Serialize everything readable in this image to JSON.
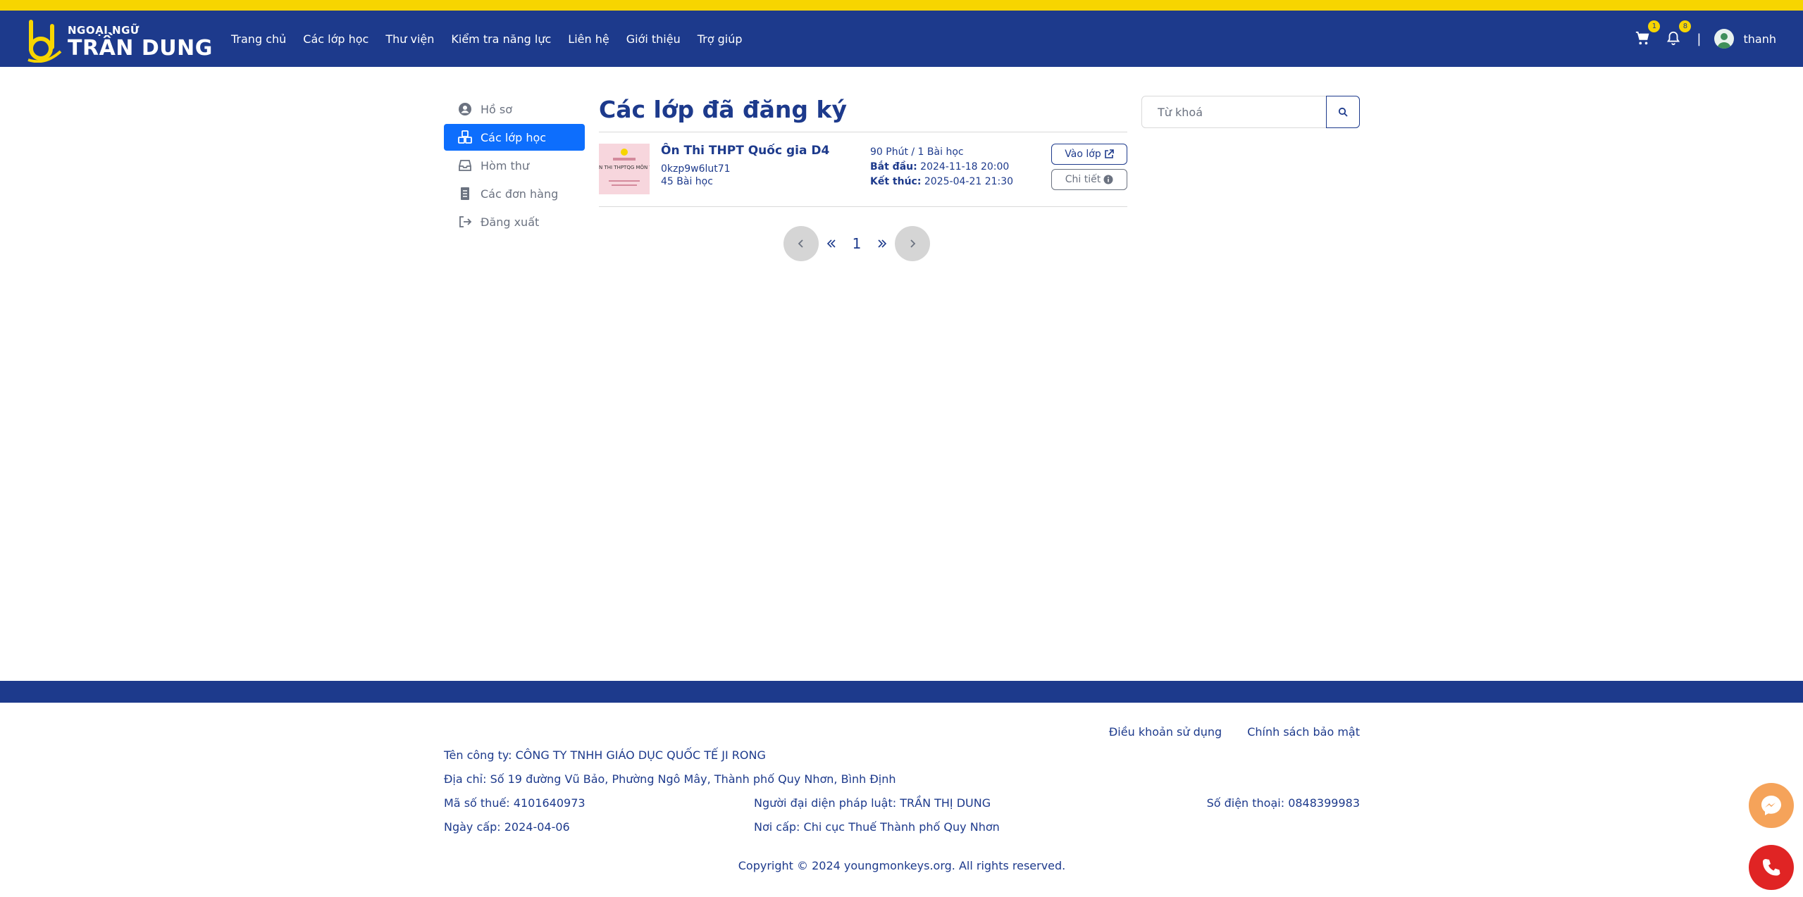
{
  "brand": {
    "small": "NGOẠI NGỮ",
    "big": "TRẦN DUNG"
  },
  "nav": {
    "links": [
      "Trang chủ",
      "Các lớp học",
      "Thư viện",
      "Kiểm tra năng lực",
      "Liên hệ",
      "Giới thiệu",
      "Trợ giúp"
    ],
    "cart_count": "1",
    "notify_count": "8",
    "separator": "|",
    "username": "thanh"
  },
  "sidebar": {
    "items": [
      {
        "label": "Hồ sơ",
        "icon": "user-circle-icon"
      },
      {
        "label": "Các lớp học",
        "icon": "cubes-icon"
      },
      {
        "label": "Hòm thư",
        "icon": "inbox-icon"
      },
      {
        "label": "Các đơn hàng",
        "icon": "receipt-icon"
      },
      {
        "label": "Đăng xuất",
        "icon": "logout-icon"
      }
    ]
  },
  "main": {
    "title": "Các lớp đã đăng ký",
    "classes": [
      {
        "thumb_text": "N THI THPTQG MÔN T",
        "name": "Ôn Thi THPT Quốc gia D4",
        "code": "0kzp9w6lut71",
        "lessons": "45 Bài học",
        "duration": "90 Phút / 1 Bài học",
        "start_label": "Bắt đầu:",
        "start": "2024-11-18 20:00",
        "end_label": "Kết thúc:",
        "end": "2025-04-21 21:30",
        "enter_label": "Vào lớp",
        "detail_label": "Chi tiết"
      }
    ],
    "pager": {
      "current": "1"
    }
  },
  "search": {
    "placeholder": "Từ khoá"
  },
  "footer": {
    "links": [
      "Điều khoản sử dụng",
      "Chính sách bảo mật"
    ],
    "company": "Tên công ty: CÔNG TY TNHH GIÁO DỤC QUỐC TẾ JI RONG",
    "address": "Địa chỉ: Số 19 đường Vũ Bảo, Phường Ngô Mây, Thành phố Quy Nhơn, Bình Định",
    "tax_id": "Mã số thuế: 4101640973",
    "representative": "Người đại diện pháp luật: TRẦN THỊ DUNG",
    "phone": "Số điện thoại: 0848399983",
    "issue_date": "Ngày cấp: 2024-04-06",
    "issue_place": "Nơi cấp: Chi cục Thuế Thành phố Quy Nhơn",
    "copyright": "Copyright © 2024 youngmonkeys.org. All rights reserved."
  },
  "colors": {
    "brand_blue": "#1d3a8c",
    "accent_yellow": "#f7d500",
    "active_blue": "#0d6efd"
  }
}
